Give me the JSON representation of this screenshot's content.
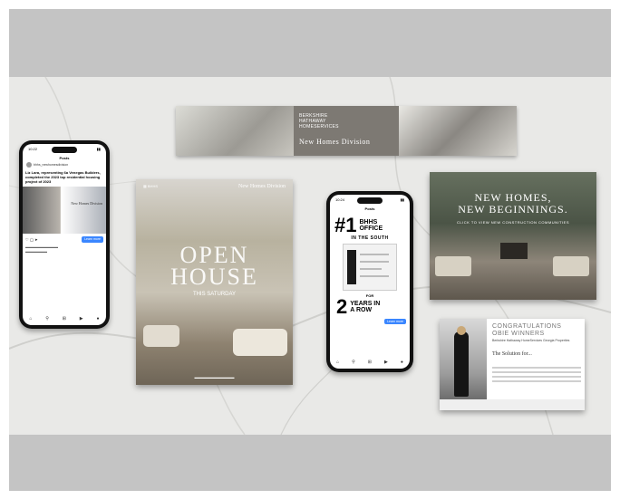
{
  "colors": {
    "band": "#c4c4c4",
    "marble": "#e9e9e7",
    "banner": "#8f8a83"
  },
  "banner": {
    "brand_line1": "BERKSHIRE",
    "brand_line2": "HATHAWAY",
    "brand_line3": "HOMESERVICES",
    "division": "New Homes Division"
  },
  "phone1": {
    "time": "10:22",
    "header": "Posts",
    "user": "bhhs_newhomesdivision",
    "headline": "Liz Lara, representing 6a Venegas Builders, completed the 2023 top residential housing project of 2023",
    "cta": "Learn more",
    "division": "New Homes Division"
  },
  "flyer": {
    "division": "New Homes Division",
    "title_line1": "OPEN",
    "title_line2": "HOUSE",
    "subtitle": "THIS SATURDAY"
  },
  "phone2": {
    "time": "10:24",
    "header": "Posts",
    "rank": "#1",
    "rank_line1": "BHHS",
    "rank_line2": "OFFICE",
    "in_south": "IN THE SOUTH",
    "for_label": "FOR",
    "years_num": "2",
    "years_line1": "YEARS IN",
    "years_line2": "A ROW",
    "cta": "Learn more"
  },
  "newhomes": {
    "title_line1": "NEW HOMES,",
    "title_line2": "NEW BEGINNINGS.",
    "subtitle": "CLICK TO VIEW NEW CONSTRUCTION COMMUNITIES"
  },
  "congrats": {
    "title_line1": "CONGRATULATIONS",
    "title_line2": "OBIE WINNERS",
    "subtitle": "Berkshire Hathaway HomeServices Georgia Properties",
    "solution": "The Solution for..."
  }
}
